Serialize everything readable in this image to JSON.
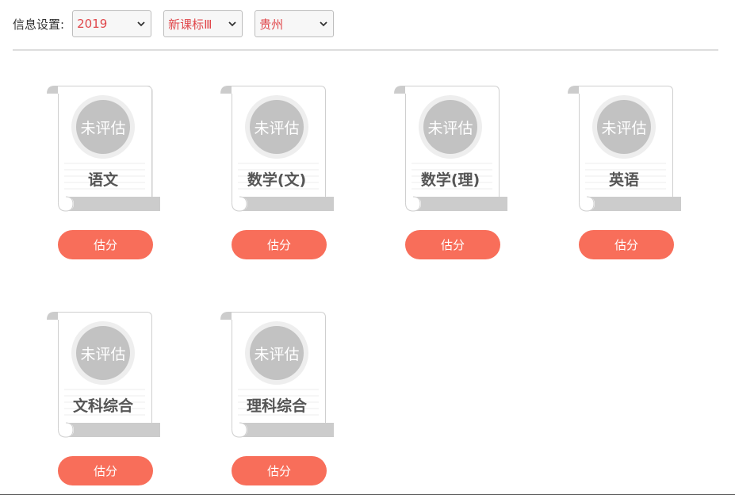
{
  "settings": {
    "label": "信息设置:",
    "year": "2019",
    "curriculum": "新课标Ⅲ",
    "province": "贵州",
    "accent_color": "#e0474b"
  },
  "subjects": [
    {
      "name": "语文",
      "status": "未评估",
      "button": "估分"
    },
    {
      "name": "数学(文)",
      "status": "未评估",
      "button": "估分"
    },
    {
      "name": "数学(理)",
      "status": "未评估",
      "button": "估分"
    },
    {
      "name": "英语",
      "status": "未评估",
      "button": "估分"
    },
    {
      "name": "文科综合",
      "status": "未评估",
      "button": "估分"
    },
    {
      "name": "理科综合",
      "status": "未评估",
      "button": "估分"
    }
  ],
  "colors": {
    "button": "#f86e5a",
    "circle": "#c2c2c2",
    "scroll_roll": "#cccccc"
  },
  "icons": {
    "select_arrow": "chevron-down-icon",
    "card_shape": "scroll-icon"
  }
}
